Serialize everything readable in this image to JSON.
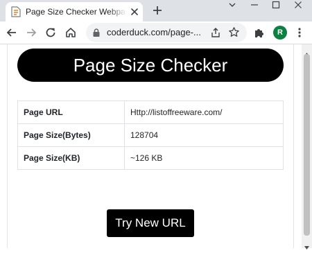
{
  "browser": {
    "tab": {
      "title": "Page Size Checker Webpage Size"
    },
    "address_bar": {
      "url": "coderduck.com/page-..."
    },
    "profile": {
      "initial": "R",
      "color": "#0b8043"
    }
  },
  "page": {
    "title": "Page Size Checker",
    "results": [
      {
        "label": "Page URL",
        "value": "Http://listoffreeware.com/"
      },
      {
        "label": "Page Size(Bytes)",
        "value": "128704"
      },
      {
        "label": "Page Size(KB)",
        "value": "~126 KB"
      }
    ],
    "try_button_label": "Try New URL"
  },
  "icons": {
    "favicon": "document-scan-icon",
    "tab_close": "close-icon",
    "new_tab": "plus-icon",
    "back": "arrow-left-icon",
    "forward": "arrow-right-icon",
    "reload": "reload-icon",
    "home": "home-icon",
    "lock": "lock-icon",
    "share": "share-icon",
    "bookmark": "star-icon",
    "extensions": "puzzle-icon",
    "menu": "kebab-menu-icon"
  },
  "colors": {
    "accent": "#000000",
    "tab_strip": "#dee1e6",
    "omnibox": "#f1f3f4"
  }
}
